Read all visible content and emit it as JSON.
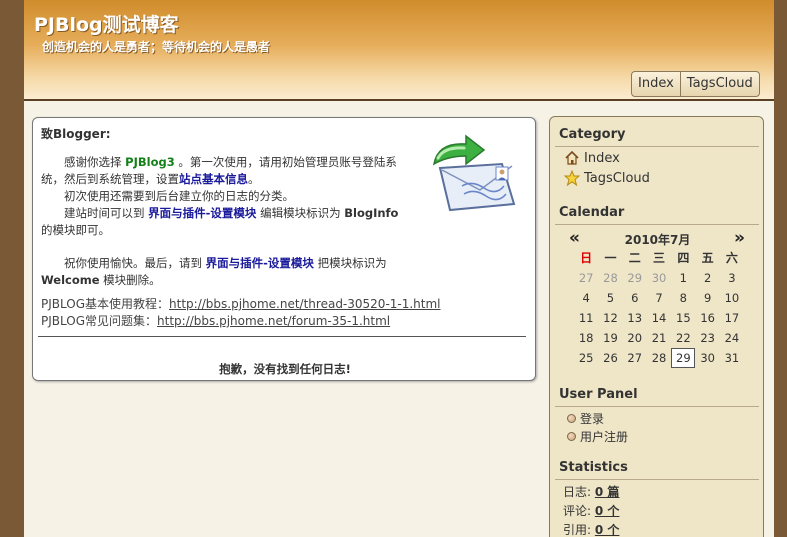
{
  "header": {
    "title": "PJBlog测试博客",
    "subtitle": "创造机会的人是勇者；等待机会的人是愚者"
  },
  "nav": {
    "items": [
      "Index",
      "TagsCloud"
    ]
  },
  "content": {
    "greeting": "致Blogger:",
    "p1_pre": "感谢你选择 ",
    "p1_brand": "PJBlog3",
    "p1_mid": " 。第一次使用，请用初始管理员账号登陆系统，然后到系统管理，设置",
    "p1_link": "站点基本信息",
    "p1_end": "。",
    "p2": "初次使用还需要到后台建立你的日志的分类。",
    "p3_pre": "建站时间可以到 ",
    "p3_link": "界面与插件-设置模块",
    "p3_mid": " 编辑模块标识为 ",
    "p3_code": "BlogInfo",
    "p3_end": "的模块即可。",
    "p4_pre": "祝你使用愉快。最后，请到 ",
    "p4_link": "界面与插件-设置模块",
    "p4_mid": " 把模块标识为 ",
    "p4_code": "Welcome",
    "p4_end": " 模块删除。",
    "link1_label": "PJBLOG基本使用教程：",
    "link1_url": "http://bbs.pjhome.net/thread-30520-1-1.html",
    "link2_label": "PJBLOG常见问题集：",
    "link2_url": "http://bbs.pjhome.net/forum-35-1.html",
    "no_logs": "抱歉，没有找到任何日志!"
  },
  "sidebar": {
    "category": {
      "title": "Category",
      "items": [
        {
          "label": "Index",
          "icon": "home-icon"
        },
        {
          "label": "TagsCloud",
          "icon": "star-icon"
        }
      ]
    },
    "calendar": {
      "title": "Calendar",
      "prev": "«",
      "next": "»",
      "month": "2010年7月",
      "weekdays": [
        "日",
        "一",
        "二",
        "三",
        "四",
        "五",
        "六"
      ],
      "weeks": [
        [
          "27",
          "28",
          "29",
          "30",
          "1",
          "2",
          "3"
        ],
        [
          "4",
          "5",
          "6",
          "7",
          "8",
          "9",
          "10"
        ],
        [
          "11",
          "12",
          "13",
          "14",
          "15",
          "16",
          "17"
        ],
        [
          "18",
          "19",
          "20",
          "21",
          "22",
          "23",
          "24"
        ],
        [
          "25",
          "26",
          "27",
          "28",
          "29",
          "30",
          "31"
        ]
      ],
      "today": "29"
    },
    "user_panel": {
      "title": "User Panel",
      "items": [
        "登录",
        "用户注册"
      ]
    },
    "statistics": {
      "title": "Statistics",
      "items": [
        {
          "label": "日志:",
          "value": "0 篇"
        },
        {
          "label": "评论:",
          "value": "0 个"
        },
        {
          "label": "引用:",
          "value": "0 个"
        }
      ]
    }
  }
}
